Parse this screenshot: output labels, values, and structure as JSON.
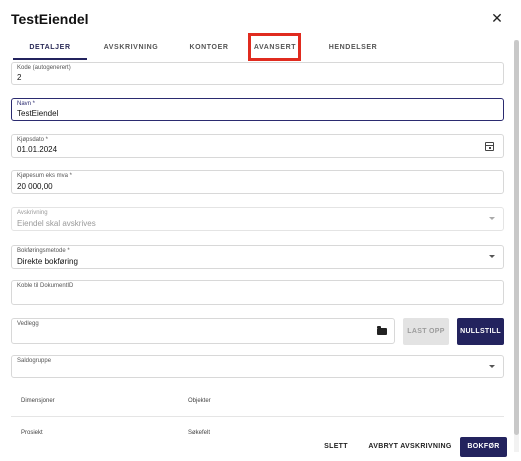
{
  "dialog": {
    "title": "TestEiendel",
    "close_icon": "close-icon"
  },
  "tabs": [
    {
      "label": "DETALJER",
      "active": true
    },
    {
      "label": "AVSKRIVNING",
      "active": false
    },
    {
      "label": "KONTOER",
      "active": false
    },
    {
      "label": "AVANSERT",
      "active": false,
      "highlighted": true
    },
    {
      "label": "HENDELSER",
      "active": false
    }
  ],
  "form": {
    "kode": {
      "label": "Kode (autogenerert)",
      "value": "2"
    },
    "navn": {
      "label": "Navn *",
      "value": "TestEiendel"
    },
    "kjopsdato": {
      "label": "Kjøpsdato *",
      "value": "01.01.2024",
      "icon": "calendar-icon"
    },
    "kjopesum": {
      "label": "Kjøpesum eks mva *",
      "value": "20 000,00"
    },
    "avskrivning": {
      "label": "Avskrivning",
      "value": "Eiendel skal avskrives"
    },
    "bokforingsmetode": {
      "label": "Bokføringsmetode *",
      "value": "Direkte bokføring"
    },
    "koble": {
      "label": "Koble til DokumentID",
      "value": ""
    },
    "vedlegg": {
      "label": "Vedlegg",
      "value": "",
      "icon": "folder-icon",
      "last_opp": "LAST OPP",
      "nullstill": "NULLSTILL"
    },
    "saldogruppe": {
      "label": "Saldogruppe",
      "value": ""
    }
  },
  "dimensions": {
    "headers": [
      "Dimensjoner",
      "Objekter"
    ],
    "rows": [
      [
        "Prosjekt",
        "Søkefelt"
      ]
    ]
  },
  "footer": {
    "slett": "SLETT",
    "avbryt": "AVBRYT AVSKRIVNING",
    "bokfor": "BOKFØR"
  },
  "colors": {
    "primary": "#23235e",
    "highlight": "#e02b1f"
  }
}
